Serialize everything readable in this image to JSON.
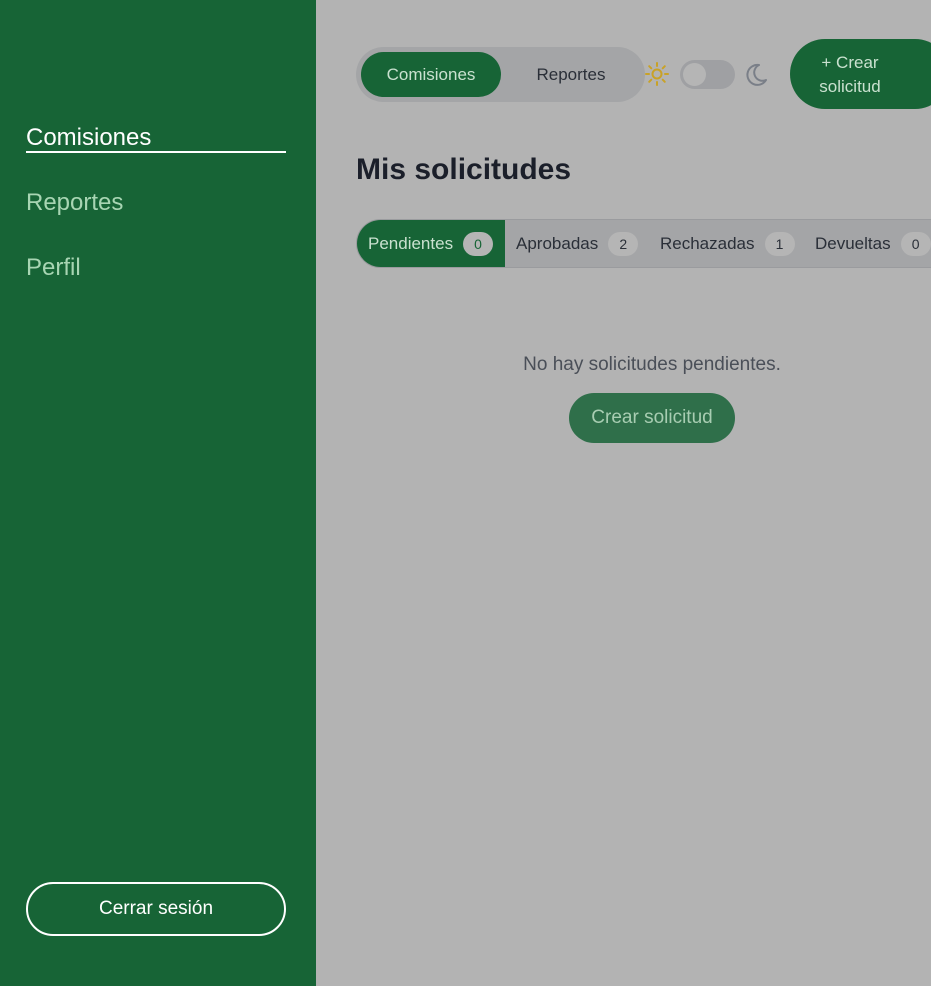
{
  "sidebar": {
    "items": [
      {
        "label": "Comisiones"
      },
      {
        "label": "Reportes"
      },
      {
        "label": "Perfil"
      }
    ],
    "logout_label": "Cerrar sesión"
  },
  "header": {
    "segments": [
      {
        "label": "Comisiones"
      },
      {
        "label": "Reportes"
      }
    ],
    "theme_light_icon": "sun-icon",
    "theme_dark_icon": "moon-icon",
    "create_button_line1": "+ Crear",
    "create_button_line2": "solicitud"
  },
  "main": {
    "title": "Mis solicitudes",
    "tabs": [
      {
        "label": "Pendientes",
        "count": "0"
      },
      {
        "label": "Aprobadas",
        "count": "2"
      },
      {
        "label": "Rechazadas",
        "count": "1"
      },
      {
        "label": "Devueltas",
        "count": "0"
      }
    ],
    "empty_message": "No hay solicitudes pendientes.",
    "create_label": "Crear solicitud"
  },
  "colors": {
    "primary": "#176436",
    "background_overlay": "#b3b3b3",
    "sun": "#c9a227"
  }
}
